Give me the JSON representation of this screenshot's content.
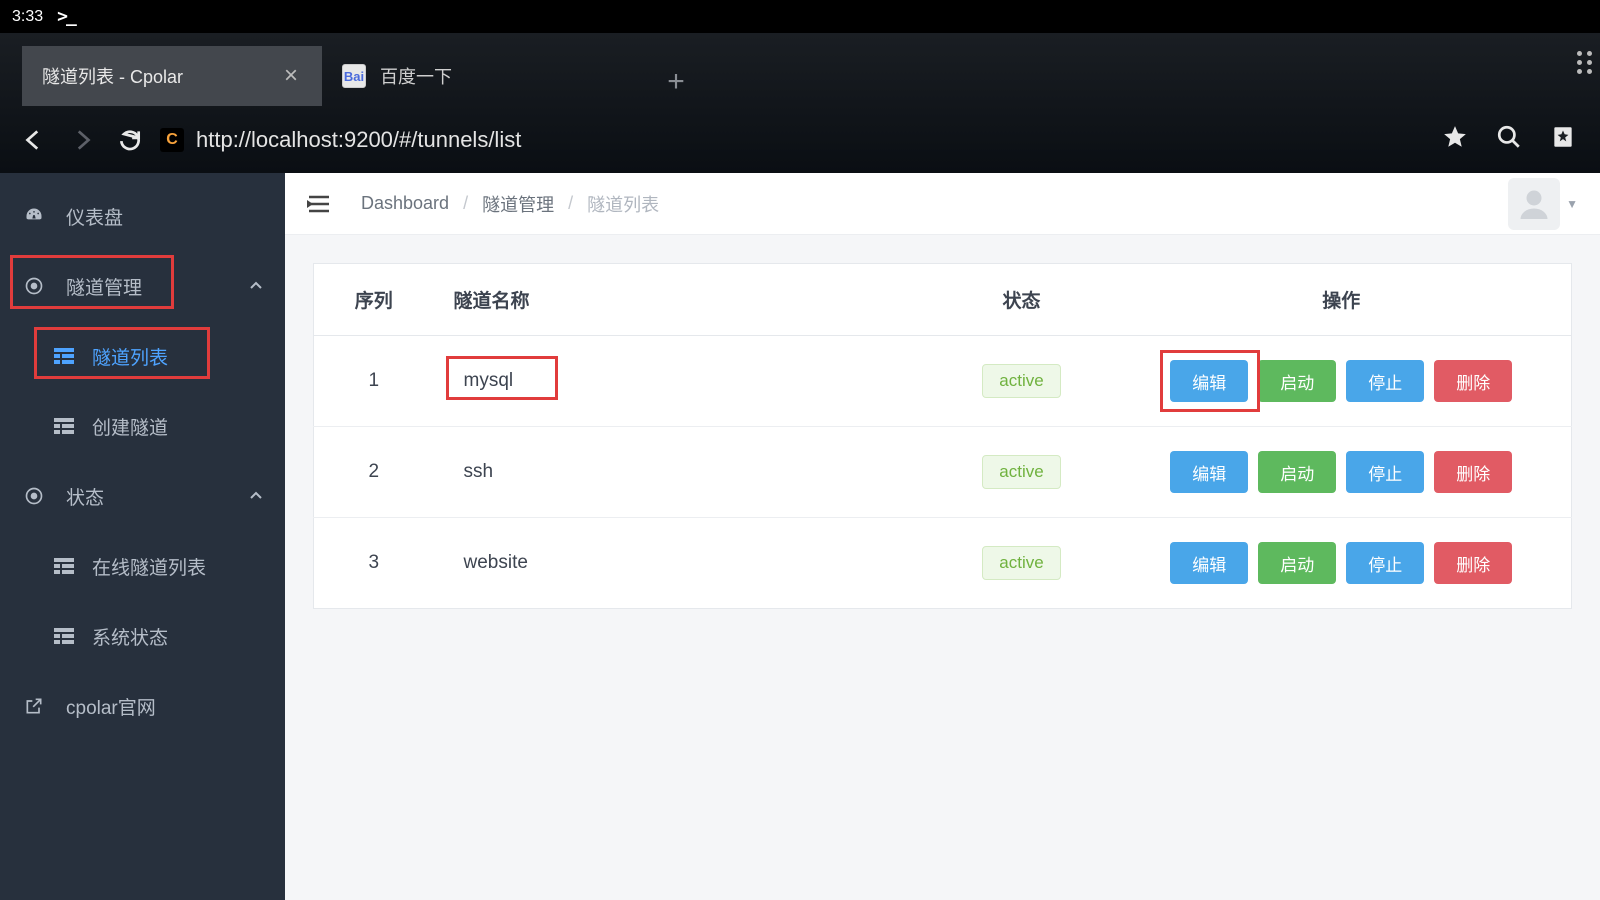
{
  "status": {
    "time": "3:33",
    "prompt": ">_"
  },
  "tabs": [
    {
      "title": "隧道列表 - Cpolar",
      "active": true
    },
    {
      "title": "百度一下",
      "active": false
    }
  ],
  "addr": {
    "url": "http://localhost:9200/#/tunnels/list",
    "site_letter": "C"
  },
  "sidebar": {
    "items": [
      {
        "label": "仪表盘",
        "icon": "dashboard"
      },
      {
        "label": "隧道管理",
        "icon": "target",
        "expanded": true,
        "highlight": true
      },
      {
        "label": "隧道列表",
        "icon": "grid",
        "sub": true,
        "active": true,
        "highlight": true
      },
      {
        "label": "创建隧道",
        "icon": "grid",
        "sub": true
      },
      {
        "label": "状态",
        "icon": "target",
        "expanded": true
      },
      {
        "label": "在线隧道列表",
        "icon": "grid",
        "sub": true
      },
      {
        "label": "系统状态",
        "icon": "grid",
        "sub": true
      },
      {
        "label": "cpolar官网",
        "icon": "external"
      }
    ]
  },
  "breadcrumb": [
    "Dashboard",
    "隧道管理",
    "隧道列表"
  ],
  "table": {
    "headers": [
      "序列",
      "隧道名称",
      "状态",
      "操作"
    ],
    "actions": {
      "edit": "编辑",
      "start": "启动",
      "stop": "停止",
      "delete": "删除"
    },
    "rows": [
      {
        "idx": "1",
        "name": "mysql",
        "status": "active",
        "highlight_edit": true,
        "highlight_name": true
      },
      {
        "idx": "2",
        "name": "ssh",
        "status": "active"
      },
      {
        "idx": "3",
        "name": "website",
        "status": "active"
      }
    ]
  }
}
